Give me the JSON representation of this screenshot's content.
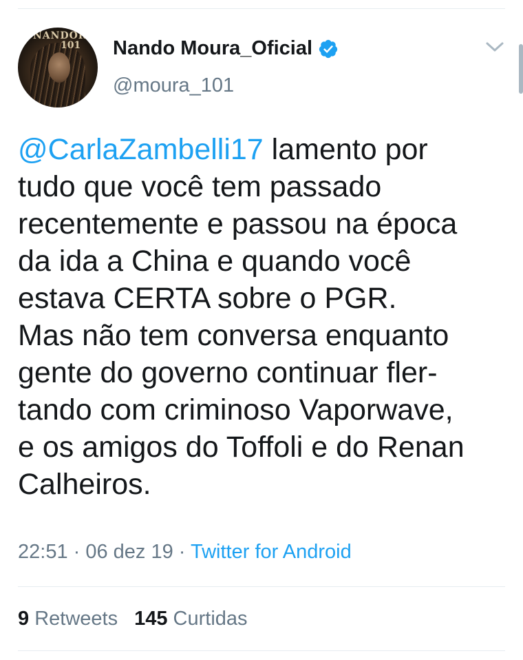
{
  "tweet": {
    "author": {
      "display_name": "Nando Moura_Oficial",
      "handle": "@moura_101",
      "verified": true,
      "avatar_logo_text": "NANDOR",
      "avatar_logo_num": "101"
    },
    "mention": "@CarlaZambelli17",
    "body": " lamento por\ntudo que você tem passado\nrecentemente e passou na época\nda ida a China e quando você\nestava CERTA sobre o PGR.\nMas não tem conversa enquanto\ngente do governo continuar fler-\ntando com criminoso Vaporwave,\ne os amigos do Toffoli e do Renan\nCalheiros.",
    "time": "22:51",
    "separator": " · ",
    "date": "06 dez 19",
    "source": "Twitter for Android",
    "retweets_count": "9",
    "retweets_label": "Retweets",
    "likes_count": "145",
    "likes_label": "Curtidas"
  },
  "colors": {
    "link": "#1da1f2",
    "secondary_text": "#657786",
    "primary_text": "#14171a",
    "divider": "#e6ecf0"
  },
  "icons": {
    "verified": "verified-badge-icon",
    "menu": "chevron-down-icon"
  }
}
